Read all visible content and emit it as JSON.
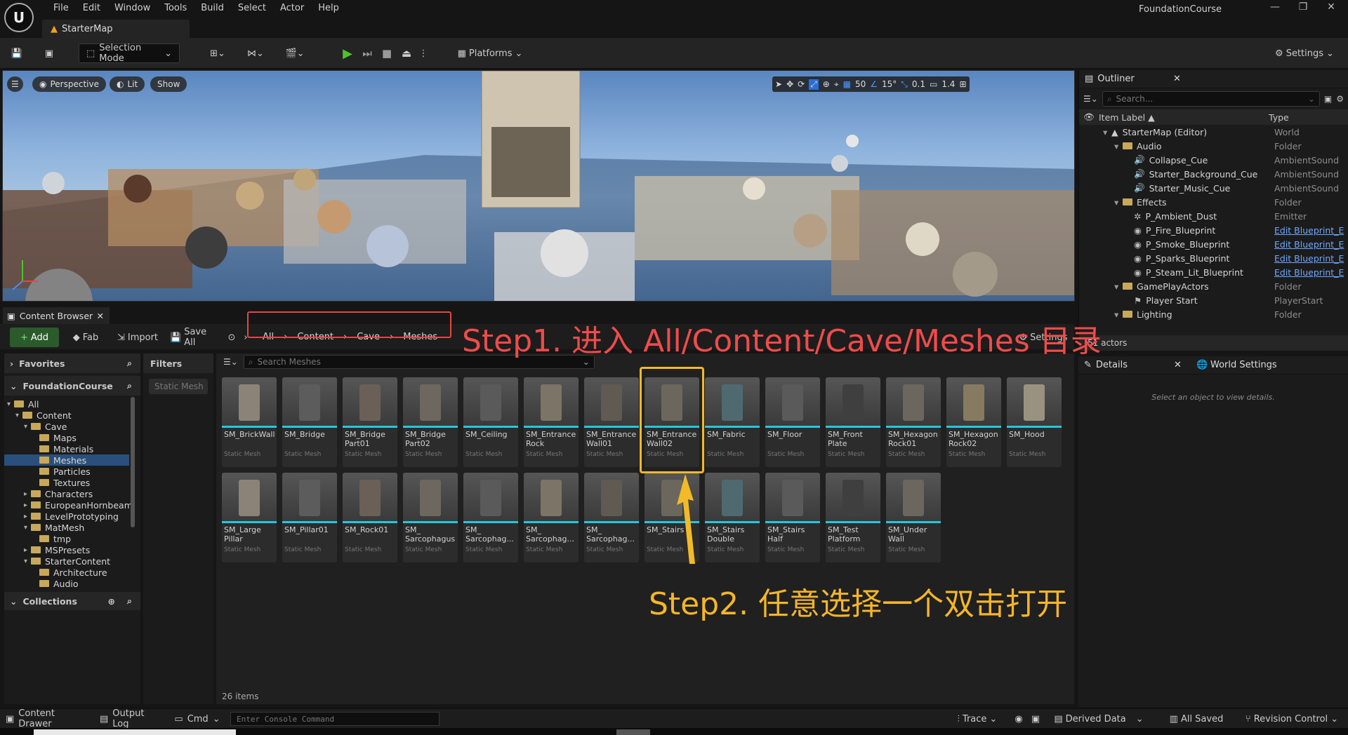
{
  "window": {
    "title": "FoundationCourse",
    "tab": "StarterMap",
    "logo": "U"
  },
  "menu": [
    "File",
    "Edit",
    "Window",
    "Tools",
    "Build",
    "Select",
    "Actor",
    "Help"
  ],
  "toolbar": {
    "selection_mode": "Selection Mode",
    "platforms": "Platforms",
    "settings": "Settings"
  },
  "viewport": {
    "perspective": "Perspective",
    "lit": "Lit",
    "show": "Show",
    "grid_size": "50",
    "angle": "15°",
    "scale": "0.1",
    "camera_speed": "1.4"
  },
  "outliner": {
    "title": "Outliner",
    "search_placeholder": "Search...",
    "col_label": "Item Label ▲",
    "col_type": "Type",
    "rows": [
      {
        "label": "StarterMap (Editor)",
        "type": "World",
        "depth": 0,
        "kind": "map"
      },
      {
        "label": "Audio",
        "type": "Folder",
        "depth": 1,
        "kind": "folder"
      },
      {
        "label": "Collapse_Cue",
        "type": "AmbientSound",
        "depth": 2,
        "kind": "sound"
      },
      {
        "label": "Starter_Background_Cue",
        "type": "AmbientSound",
        "depth": 2,
        "kind": "sound"
      },
      {
        "label": "Starter_Music_Cue",
        "type": "AmbientSound",
        "depth": 2,
        "kind": "sound"
      },
      {
        "label": "Effects",
        "type": "Folder",
        "depth": 1,
        "kind": "folder"
      },
      {
        "label": "P_Ambient_Dust",
        "type": "Emitter",
        "depth": 2,
        "kind": "emitter"
      },
      {
        "label": "P_Fire_Blueprint",
        "type": "Edit Blueprint_E",
        "depth": 2,
        "kind": "bp"
      },
      {
        "label": "P_Smoke_Blueprint",
        "type": "Edit Blueprint_E",
        "depth": 2,
        "kind": "bp"
      },
      {
        "label": "P_Sparks_Blueprint",
        "type": "Edit Blueprint_E",
        "depth": 2,
        "kind": "bp"
      },
      {
        "label": "P_Steam_Lit_Blueprint",
        "type": "Edit Blueprint_E",
        "depth": 2,
        "kind": "bp"
      },
      {
        "label": "GamePlayActors",
        "type": "Folder",
        "depth": 1,
        "kind": "folder"
      },
      {
        "label": "Player Start",
        "type": "PlayerStart",
        "depth": 2,
        "kind": "flag"
      },
      {
        "label": "Lighting",
        "type": "Folder",
        "depth": 1,
        "kind": "folder"
      }
    ],
    "actors_count": "51 actors"
  },
  "details": {
    "tab_details": "Details",
    "tab_world": "World Settings",
    "empty": "Select an object to view details."
  },
  "content_browser": {
    "tab": "Content Browser",
    "add": "Add",
    "fab": "Fab",
    "import": "Import",
    "save_all": "Save All",
    "breadcrumb": [
      "All",
      "Content",
      "Cave",
      "Meshes"
    ],
    "settings": "Settings",
    "search_placeholder": "Search Meshes",
    "favorites": "Favorites",
    "project": "FoundationCourse",
    "collections": "Collections",
    "filters": "Filters",
    "filter_chip": "Static Mesh",
    "item_count": "26 items",
    "tree": [
      {
        "label": "All",
        "depth": 0,
        "open": true
      },
      {
        "label": "Content",
        "depth": 1,
        "open": true
      },
      {
        "label": "Cave",
        "depth": 2,
        "open": true
      },
      {
        "label": "Maps",
        "depth": 3
      },
      {
        "label": "Materials",
        "depth": 3
      },
      {
        "label": "Meshes",
        "depth": 3,
        "selected": true
      },
      {
        "label": "Particles",
        "depth": 3
      },
      {
        "label": "Textures",
        "depth": 3
      },
      {
        "label": "Characters",
        "depth": 2,
        "closed": true
      },
      {
        "label": "EuropeanHornbeam",
        "depth": 2,
        "closed": true
      },
      {
        "label": "LevelPrototyping",
        "depth": 2,
        "closed": true
      },
      {
        "label": "MatMesh",
        "depth": 2,
        "open": true
      },
      {
        "label": "tmp",
        "depth": 3
      },
      {
        "label": "MSPresets",
        "depth": 2,
        "closed": true
      },
      {
        "label": "StarterContent",
        "depth": 2,
        "open": true
      },
      {
        "label": "Architecture",
        "depth": 3
      },
      {
        "label": "Audio",
        "depth": 3
      }
    ],
    "assets": [
      {
        "name": "SM_BrickWall",
        "type": "Static Mesh"
      },
      {
        "name": "SM_Bridge",
        "type": "Static Mesh"
      },
      {
        "name": "SM_Bridge Part01",
        "type": "Static Mesh"
      },
      {
        "name": "SM_Bridge Part02",
        "type": "Static Mesh"
      },
      {
        "name": "SM_Ceiling",
        "type": "Static Mesh"
      },
      {
        "name": "SM_Entrance Rock",
        "type": "Static Mesh"
      },
      {
        "name": "SM_Entrance Wall01",
        "type": "Static Mesh"
      },
      {
        "name": "SM_Entrance Wall02",
        "type": "Static Mesh",
        "highlighted": true
      },
      {
        "name": "SM_Fabric",
        "type": "Static Mesh"
      },
      {
        "name": "SM_Floor",
        "type": "Static Mesh"
      },
      {
        "name": "SM_Front Plate",
        "type": "Static Mesh"
      },
      {
        "name": "SM_Hexagon Rock01",
        "type": "Static Mesh"
      },
      {
        "name": "SM_Hexagon Rock02",
        "type": "Static Mesh"
      },
      {
        "name": "SM_Hood",
        "type": "Static Mesh"
      },
      {
        "name": "SM_Large Pillar",
        "type": "Static Mesh"
      },
      {
        "name": "SM_Pillar01",
        "type": "Static Mesh"
      },
      {
        "name": "SM_Rock01",
        "type": "Static Mesh"
      },
      {
        "name": "SM_ Sarcophagus",
        "type": "Static Mesh"
      },
      {
        "name": "SM_ Sarcophag...",
        "type": "Static Mesh"
      },
      {
        "name": "SM_ Sarcophag...",
        "type": "Static Mesh"
      },
      {
        "name": "SM_ Sarcophag...",
        "type": "Static Mesh"
      },
      {
        "name": "SM_Stairs",
        "type": "Static Mesh"
      },
      {
        "name": "SM_Stairs Double",
        "type": "Static Mesh"
      },
      {
        "name": "SM_Stairs Half",
        "type": "Static Mesh"
      },
      {
        "name": "SM_Test Platform",
        "type": "Static Mesh"
      },
      {
        "name": "SM_Under Wall",
        "type": "Static Mesh"
      }
    ]
  },
  "annotations": {
    "step1": "Step1. 进入 All/Content/Cave/Meshes 目录",
    "step2": "Step2. 任意选择一个双击打开"
  },
  "statusbar": {
    "content_drawer": "Content Drawer",
    "output_log": "Output Log",
    "cmd": "Cmd",
    "console_placeholder": "Enter Console Command",
    "trace": "Trace",
    "derived_data": "Derived Data",
    "all_saved": "All Saved",
    "revision_control": "Revision Control"
  },
  "colors": {
    "accent": "#25c8dc",
    "play": "#4fc22b",
    "annot_red": "#ef4b4b",
    "annot_yellow": "#f5b52a"
  }
}
